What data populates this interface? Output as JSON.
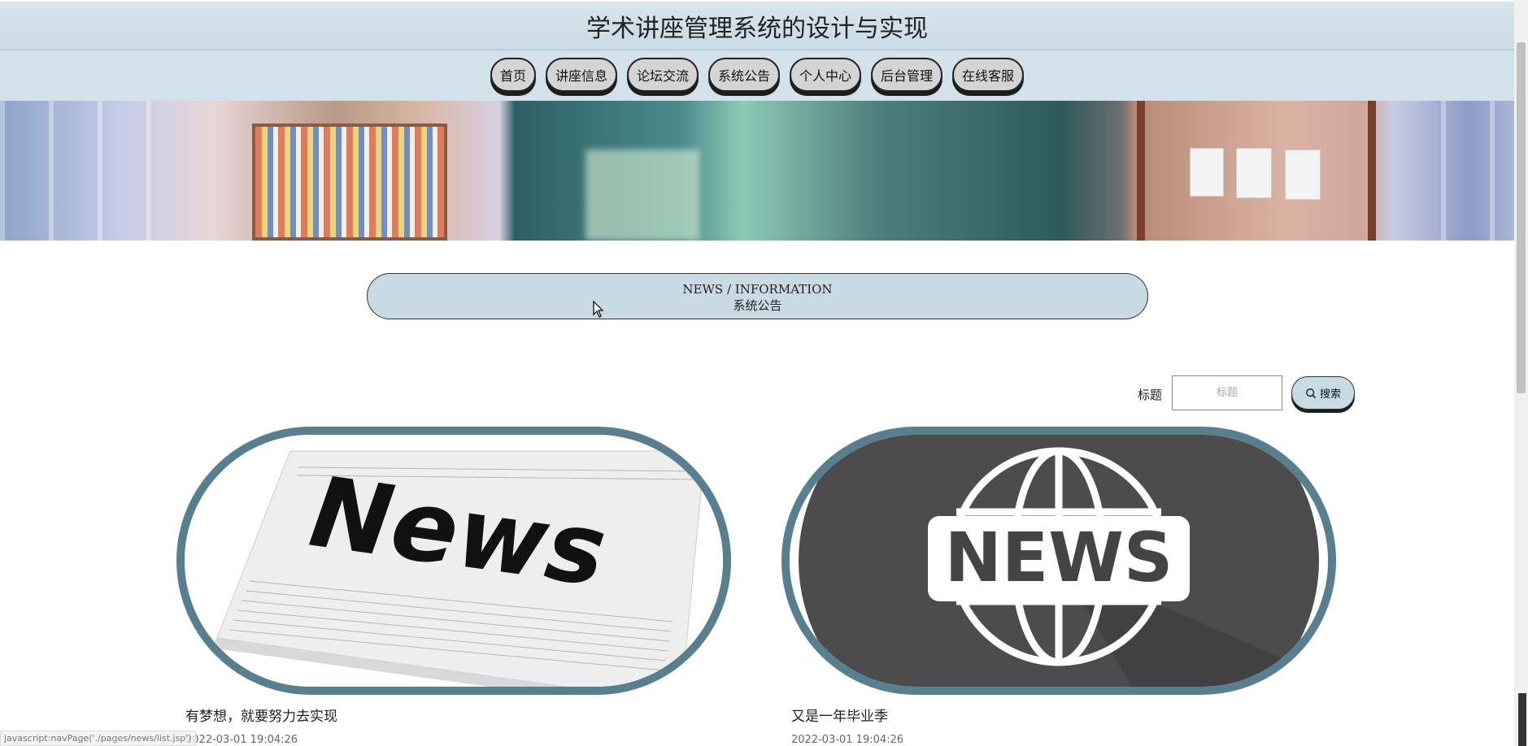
{
  "site": {
    "title": "学术讲座管理系统的设计与实现"
  },
  "nav": {
    "items": [
      {
        "label": "首页"
      },
      {
        "label": "讲座信息"
      },
      {
        "label": "论坛交流"
      },
      {
        "label": "系统公告"
      },
      {
        "label": "个人中心"
      },
      {
        "label": "后台管理"
      },
      {
        "label": "在线客服"
      }
    ]
  },
  "section": {
    "en": "NEWS / INFORMATION",
    "zh": "系统公告"
  },
  "search": {
    "label": "标题",
    "placeholder": "标题",
    "button_label": "搜索"
  },
  "news": [
    {
      "title": "有梦想，就要努力去实现",
      "date": "2022-03-01 19:04:26",
      "image_text": "News"
    },
    {
      "title": "又是一年毕业季",
      "date": "2022-03-01 19:04:26",
      "image_text": "NEWS"
    }
  ],
  "status_bar": {
    "url": "javascript:navPage('./pages/news/list.jsp')"
  },
  "colors": {
    "header_bg": "#d3e2ea",
    "section_bg": "#c8dae3",
    "card_border": "#577f8f"
  }
}
